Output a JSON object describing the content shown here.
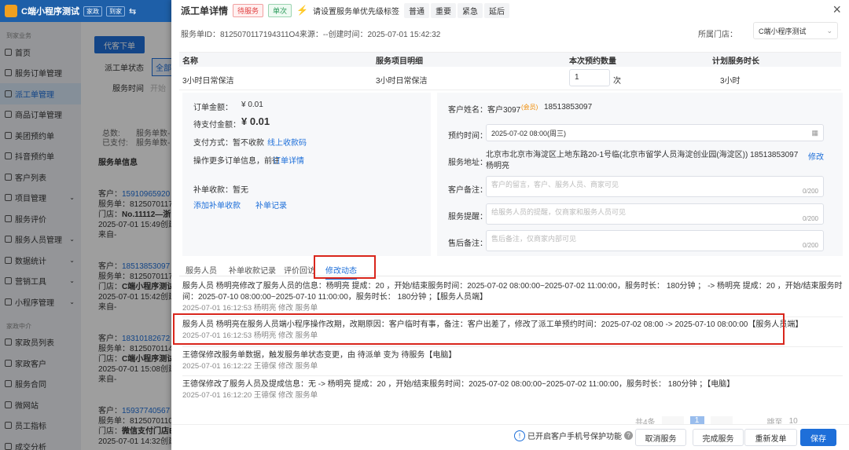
{
  "app": {
    "title": "C端小程序测试",
    "tag1": "家政",
    "tag2": "到家"
  },
  "sidebar": {
    "section1": "到家业务",
    "items": [
      {
        "label": "首页",
        "arrow": ""
      },
      {
        "label": "服务订单管理",
        "arrow": ""
      },
      {
        "label": "派工单管理",
        "arrow": "",
        "active": true
      },
      {
        "label": "商品订单管理",
        "arrow": ""
      },
      {
        "label": "美团预约单",
        "arrow": ""
      },
      {
        "label": "抖音预约单",
        "arrow": ""
      },
      {
        "label": "客户列表",
        "arrow": ""
      },
      {
        "label": "项目管理",
        "arrow": "⌄"
      },
      {
        "label": "服务评价",
        "arrow": ""
      },
      {
        "label": "服务人员管理",
        "arrow": "⌄"
      },
      {
        "label": "数据统计",
        "arrow": "⌄"
      },
      {
        "label": "营销工具",
        "arrow": "⌄"
      },
      {
        "label": "小程序管理",
        "arrow": "⌄"
      }
    ],
    "section2": "家政中介",
    "items2": [
      {
        "label": "家政员列表"
      },
      {
        "label": "家政客户"
      },
      {
        "label": "服务合同"
      },
      {
        "label": "微网站"
      },
      {
        "label": "员工指标"
      },
      {
        "label": "成交分析"
      }
    ]
  },
  "bg": {
    "dispatch_btn": "代客下单",
    "status_label": "派工单状态",
    "status_all": "全部",
    "time_label": "服务时间",
    "time_ph": "开始",
    "total": "总数:",
    "paid": "已支付:",
    "svc1": "服务单数-",
    "svc2": "服务单数-",
    "section": "服务单信息",
    "cards": [
      {
        "cust": "客户：",
        "phone": "15910965920",
        "no": "服务单：8125070117",
        "store": "门店：",
        "store_name": "No.11112—浙",
        "created": "2025-07-01 15:49创建",
        "source": "来自-"
      },
      {
        "cust": "客户：",
        "phone": "18513853097",
        "no": "服务单：8125070117",
        "store": "门店：",
        "store_name": "C端小程序测试·",
        "created": "2025-07-01 15:42创建",
        "source": "来自-"
      },
      {
        "cust": "客户：",
        "phone": "18310182672",
        "no": "服务单：8125070114",
        "store": "门店：",
        "store_name": "C端小程序测试·",
        "created": "2025-07-01 15:08创建",
        "source": "来自-"
      },
      {
        "cust": "客户：",
        "phone": "15937740567",
        "no": "服务单：8125070110",
        "store": "门店：",
        "store_name": "微信支付门店B",
        "created": "2025-07-01 14:32创建",
        "source": ""
      }
    ]
  },
  "drawer": {
    "title": "派工单详情",
    "status": "待服务",
    "type": "单次",
    "prio_hint": "请设置服务单优先级标签",
    "prio": [
      "普通",
      "重要",
      "紧急",
      "延后"
    ],
    "close": "×",
    "info": "服务单ID：8125070117194311O4来源：--创建时间：2025-07-01 15:42:32",
    "store_label": "所属门店：",
    "store_value": "C端小程序测试",
    "table_headers": [
      "名称",
      "服务项目明细",
      "本次预约数量",
      "计划服务时长"
    ],
    "table_row": {
      "name": "3小时日常保洁",
      "detail": "3小时日常保洁",
      "qty": "1",
      "unit": "次",
      "duration": "3小时"
    },
    "left": {
      "order_amount_label": "订单金额：",
      "order_amount": "¥ 0.01",
      "pay_label": "待支付金额：",
      "pay": "¥ 0.01",
      "method_label": "支付方式：暂不收款",
      "collect_link": "线上收款码",
      "more": "操作更多订单信息，前往",
      "more_link": "订单详情",
      "supp_label": "补单收款：暂无",
      "supp_add": "添加补单收款",
      "supp_record": "补单记录"
    },
    "right": {
      "cust_label": "客户姓名：",
      "cust": "客户3097",
      "cust_tag": "(会员)",
      "cust_phone": "18513853097",
      "time_label": "预约时间：",
      "time_value": "2025-07-02 08:00(周三)",
      "addr_label": "服务地址：",
      "addr_value": "北京市北京市海淀区上地东路20-1号临(北京市留学人员海淀创业园(海淀区)) 18513853097  杨明亮",
      "addr_edit": "修改",
      "note_label": "客户备注：",
      "note_ph": "客户的留言，客户、服务人员、商家可见",
      "note_count": "0/200",
      "remind_label": "服务提醒：",
      "remind_ph": "给服务人员的提醒，仅商家和服务人员可见",
      "remind_count": "0/200",
      "after_label": "售后备注：",
      "after_ph": "售后备注，仅商家内部可见",
      "after_count": "0/200"
    },
    "tabs": [
      "服务人员",
      "补单收款记录",
      "评价回访",
      "修改动态"
    ],
    "logs": [
      {
        "text": "服务人员 杨明亮修改了服务人员的信息：杨明亮 提成：20 ，开始/结束服务时间：2025-07-02 08:00:00~2025-07-02 11:00:00，服务时长： 180分钟 ； -> 杨明亮 提成：20 ，开始/结束服务时间：2025-07-10 08:00:00~2025-07-10 11:00:00，服务时长： 180分钟 ；【服务人员端】",
        "meta": "2025-07-01 16:12:53  杨明亮  修改  服务单"
      },
      {
        "text": "服务人员 杨明亮在服务人员端小程序操作改期，改期原因：客户临时有事，备注：客户出差了，修改了派工单预约时间：2025-07-02 08:00 -> 2025-07-10 08:00:00【服务人员端】",
        "meta": "2025-07-01 16:12:53  杨明亮  修改  服务单"
      },
      {
        "text": "王德保修改服务单数据，触发服务单状态变更，由 待派单 变为 待服务【电脑】",
        "meta": "2025-07-01 16:12:22  王德保  修改  服务单"
      },
      {
        "text": "王德保修改了服务人员及提成信息：无 -> 杨明亮 提成：20 ，开始/结束服务时间：2025-07-02 08:00:00~2025-07-02 11:00:00，服务时长： 180分钟 ；【电脑】",
        "meta": "2025-07-01 16:12:20  王德保  修改  服务单"
      }
    ],
    "footer": {
      "privacy": "已开启客户手机号保护功能",
      "cancel": "取消服务",
      "finish": "完成服务",
      "reorder": "重新发单",
      "save": "保存",
      "total": "共4条",
      "page": "1",
      "jump": "跳至",
      "per": "10"
    },
    "colors": {
      "primary": "#1e6fd9",
      "highlight": "#d9261c"
    }
  }
}
